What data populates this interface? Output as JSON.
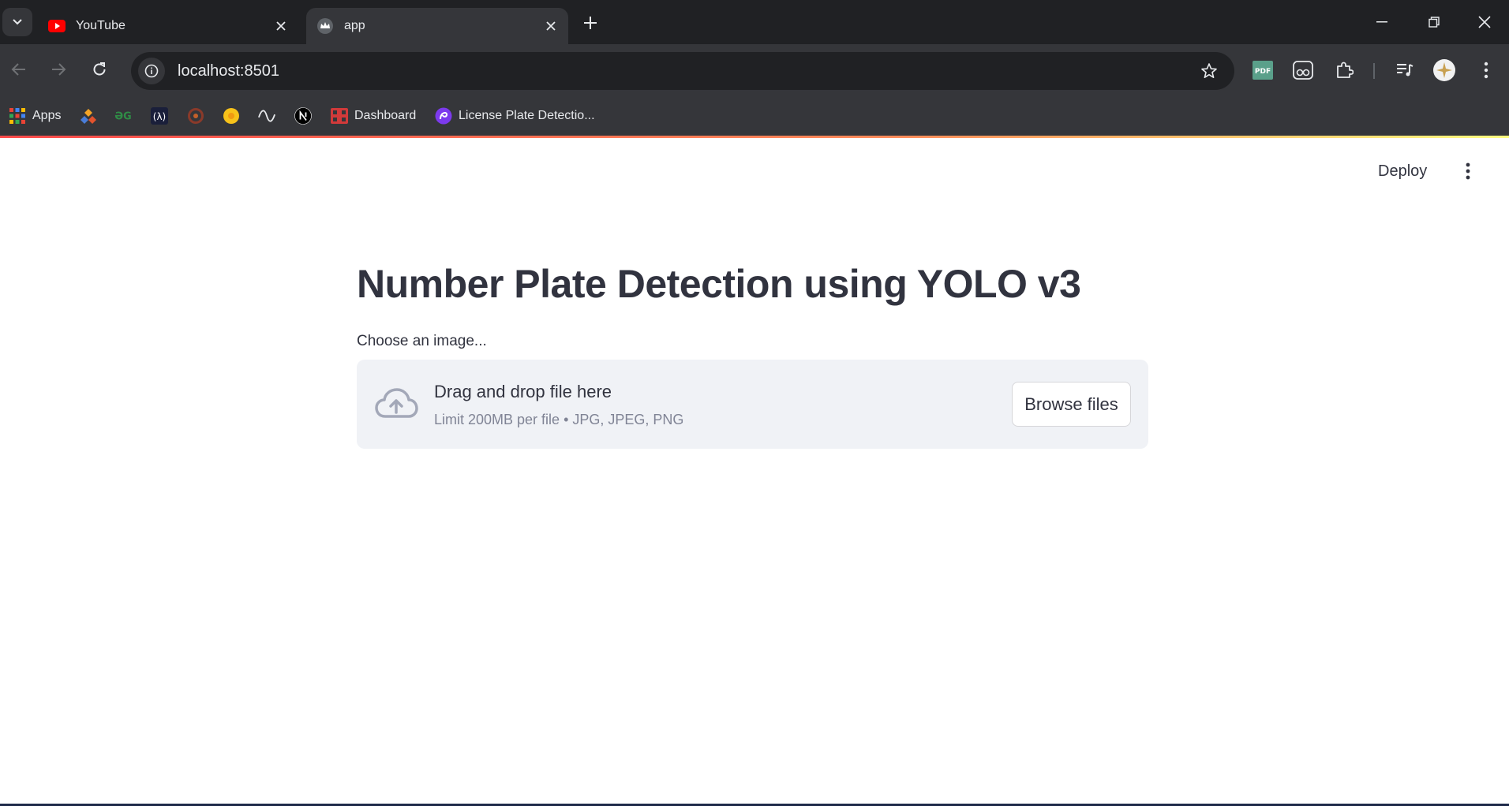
{
  "browser": {
    "tabs": [
      {
        "label": "YouTube",
        "favicon": "youtube-icon",
        "active": false
      },
      {
        "label": "app",
        "favicon": "streamlit-crown-icon",
        "active": true
      }
    ],
    "url": "localhost:8501",
    "bookmarks": [
      {
        "label": "Apps",
        "icon": "apps-grid-icon"
      },
      {
        "label": "",
        "icon": "bookmark-diamond-icon"
      },
      {
        "label": "",
        "icon": "geeksforgeeks-icon"
      },
      {
        "label": "",
        "icon": "bookmark-lambda-icon"
      },
      {
        "label": "",
        "icon": "bookmark-circle-icon"
      },
      {
        "label": "",
        "icon": "bookmark-sun-icon"
      },
      {
        "label": "",
        "icon": "bookmark-wave-icon"
      },
      {
        "label": "",
        "icon": "nextjs-icon"
      },
      {
        "label": "Dashboard",
        "icon": "dashboard-icon"
      },
      {
        "label": "License Plate Detectio...",
        "icon": "roboflow-icon"
      }
    ]
  },
  "app": {
    "deploy_label": "Deploy",
    "title": "Number Plate Detection using YOLO v3",
    "uploader": {
      "label": "Choose an image...",
      "drop_text": "Drag and drop file here",
      "limit_text": "Limit 200MB per file • JPG, JPEG, PNG",
      "browse_label": "Browse files"
    }
  },
  "colors": {
    "chrome_dark": "#202124",
    "chrome_toolbar": "#35363a",
    "text_primary": "#31333f",
    "text_muted": "#808495",
    "dropzone_bg": "#f0f2f6",
    "accent_red": "#ff4b4b"
  }
}
